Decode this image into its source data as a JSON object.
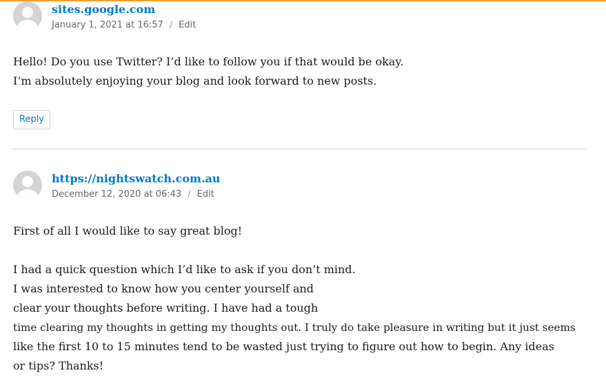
{
  "comments": [
    {
      "author": "sites.google.com",
      "date": "January 1, 2021 at 16:57",
      "separator": "/",
      "edit_label": "Edit",
      "paragraphs": [
        "Hello! Do you use Twitter? I’d like to follow you if that would be okay.",
        "I’m absolutely enjoying your blog and look forward to new posts."
      ],
      "reply_label": "Reply"
    },
    {
      "author": "https://nightswatch.com.au",
      "date": "December 12, 2020 at 06:43",
      "separator": "/",
      "edit_label": "Edit",
      "paragraphs": [
        "First of all I would like to say great blog!",
        "I had a quick question which I’d like to ask if you don’t mind.",
        "I was interested to know how you center yourself and",
        "clear your thoughts before writing. I have had a tough",
        "time clearing my thoughts in getting my thoughts out. I truly do take pleasure in writing but it just seems",
        "like the first 10 to 15 minutes tend to be wasted just trying to figure out how to begin. Any ideas",
        "or tips? Thanks!"
      ]
    }
  ],
  "colors": {
    "link": "#007acc",
    "meta": "#686868",
    "top_border": "#f0a030",
    "divider": "#d1d1d1"
  }
}
